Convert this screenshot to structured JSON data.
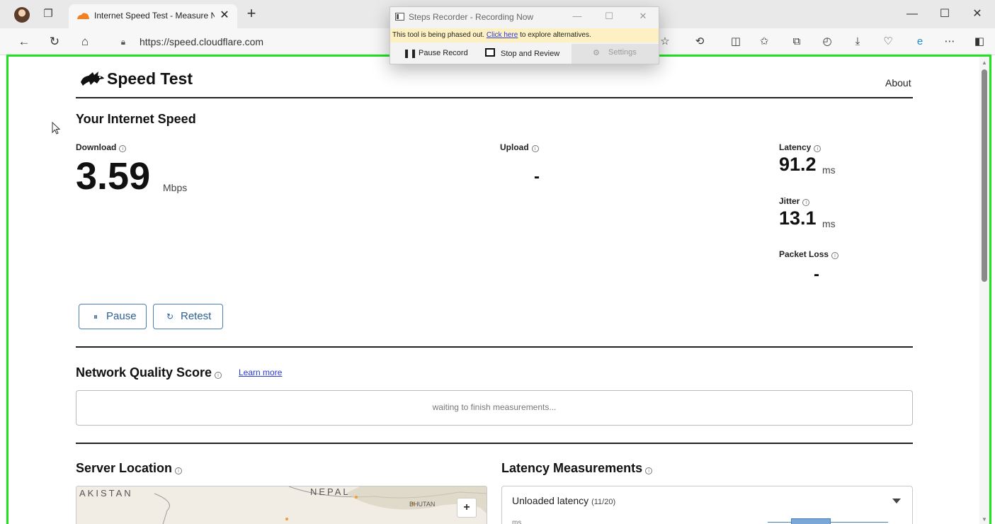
{
  "browser": {
    "tab_title": "Internet Speed Test - Measure N",
    "url": "https://speed.cloudflare.com",
    "new_tab_glyph": "+",
    "icons": [
      "profile-avatar",
      "tab-actions-icon",
      "back-icon",
      "refresh-icon",
      "home-icon",
      "lock-icon",
      "favorite-star-icon",
      "extensions-icon",
      "split-screen-icon",
      "favorites-icon",
      "collections-icon",
      "history-icon",
      "download-icon",
      "browser-essentials-icon",
      "edge-icon",
      "more-icon",
      "sidebar-icon"
    ]
  },
  "steps_recorder": {
    "title": "Steps Recorder - Recording Now",
    "notice_prefix": "This tool is being phased out. ",
    "notice_link": "Click here",
    "notice_suffix": " to explore alternatives.",
    "pause_label": "Pause Record",
    "stop_label": "Stop and Review",
    "settings_label": "Settings"
  },
  "site": {
    "logo_text": "Speed Test",
    "about_label": "About"
  },
  "speed": {
    "section_title": "Your Internet Speed",
    "download_label": "Download",
    "download_value": "3.59",
    "download_unit": "Mbps",
    "upload_label": "Upload",
    "upload_value": "-",
    "latency_label": "Latency",
    "latency_value": "91.2",
    "latency_unit": "ms",
    "jitter_label": "Jitter",
    "jitter_value": "13.1",
    "jitter_unit": "ms",
    "packet_loss_label": "Packet Loss",
    "packet_loss_value": "-",
    "pause_label": "Pause",
    "retest_label": "Retest"
  },
  "quality": {
    "title": "Network Quality Score",
    "learn_more": "Learn more",
    "status": "waiting to finish measurements..."
  },
  "server": {
    "title": "Server Location",
    "map_labels": [
      "AKISTAN",
      "NEPAL",
      "BHUTAN"
    ],
    "zoom_in": "+"
  },
  "latency_measurements": {
    "title": "Latency Measurements",
    "selected": "Unloaded latency",
    "count": "(11/20)",
    "axis_unit": "ms"
  },
  "colors": {
    "highlight_border": "#22e022",
    "accent_blue": "#4a7fb6",
    "link": "#2a3ad6",
    "notice_bg": "#fdf1c4"
  }
}
